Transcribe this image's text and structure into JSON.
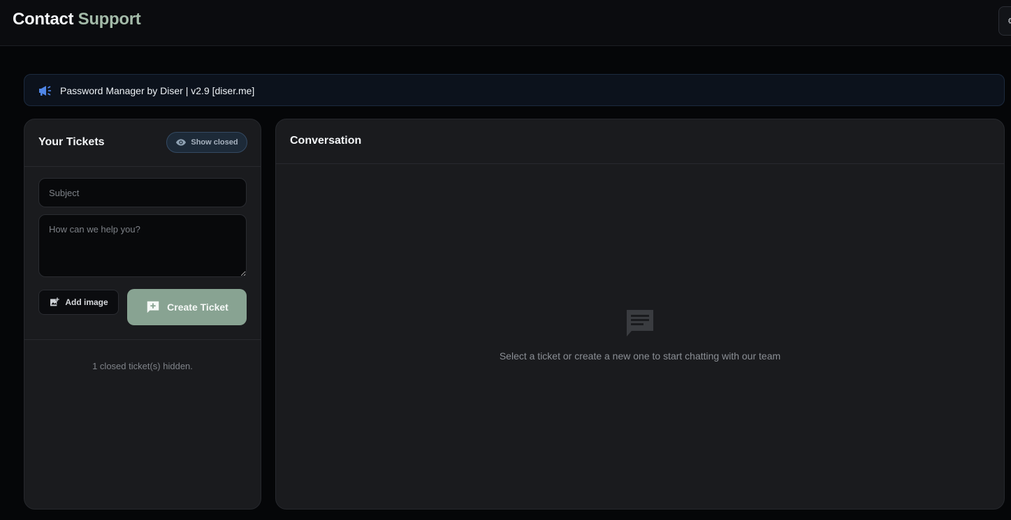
{
  "header": {
    "title_word1": "Contact",
    "title_word2": "Support"
  },
  "announcement": {
    "icon": "megaphone-icon",
    "text": "Password Manager by Diser | v2.9 [diser.me]"
  },
  "tickets_panel": {
    "title": "Your Tickets",
    "show_closed_label": "Show closed",
    "show_closed_icon": "eye-icon",
    "subject_placeholder": "Subject",
    "message_placeholder": "How can we help you?",
    "add_image_label": "Add image",
    "add_image_icon": "add-photo-icon",
    "create_ticket_label": "Create Ticket",
    "create_ticket_icon": "add-comment-icon",
    "hidden_note": "1 closed ticket(s) hidden."
  },
  "conversation_panel": {
    "title": "Conversation",
    "empty_icon": "chat-icon",
    "empty_text": "Select a ticket or create a new one to start chatting with our team"
  },
  "colors": {
    "background": "#050608",
    "panel": "#1a1b1e",
    "accent": "#88a392",
    "title_accent": "#a4bba9",
    "announcement_icon": "#4f86e8"
  }
}
